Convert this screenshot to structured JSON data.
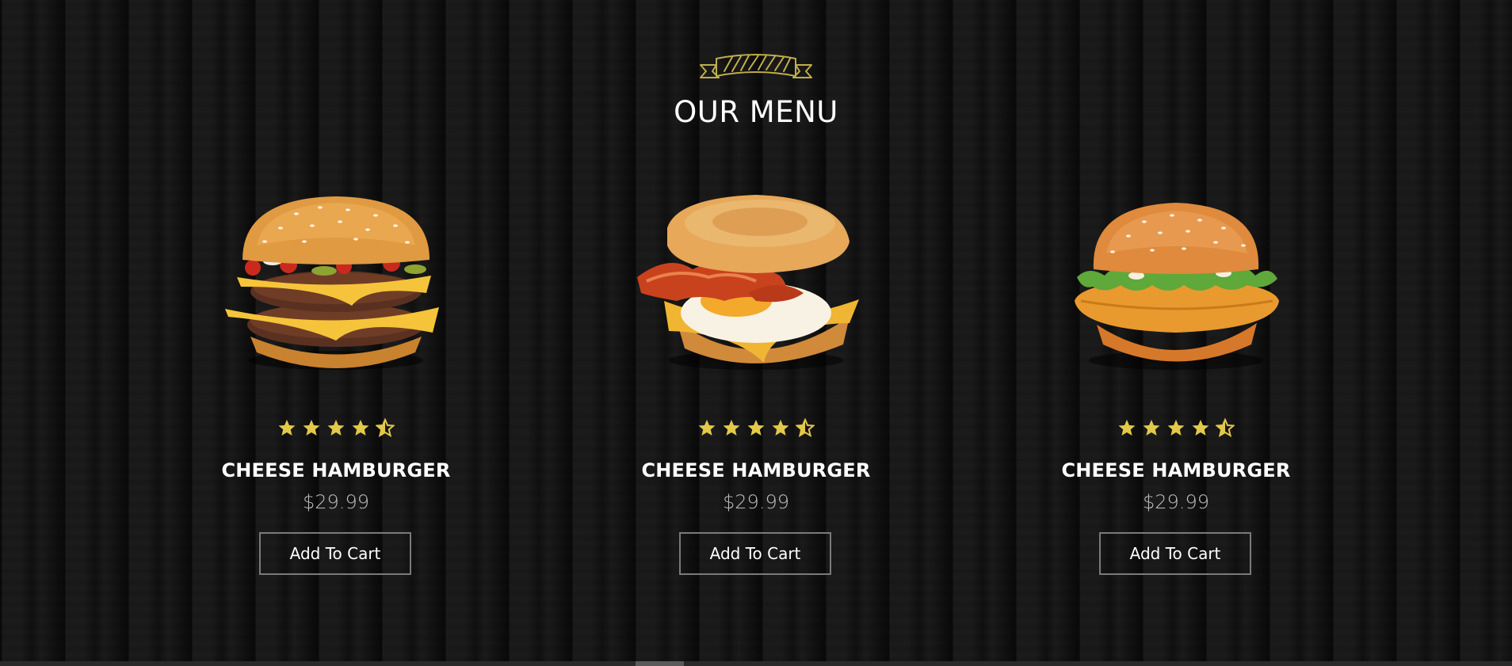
{
  "section": {
    "title": "OUR MENU"
  },
  "colors": {
    "star": "#e2c94a",
    "background": "#141414"
  },
  "menu_items": [
    {
      "name": "CHEESE HAMBURGER",
      "price": "$29.99",
      "rating": 4.5,
      "button": "Add To Cart",
      "image": "double-cheeseburger"
    },
    {
      "name": "CHEESE HAMBURGER",
      "price": "$29.99",
      "rating": 4.5,
      "button": "Add To Cart",
      "image": "bacon-egg-muffin"
    },
    {
      "name": "CHEESE HAMBURGER",
      "price": "$29.99",
      "rating": 4.5,
      "button": "Add To Cart",
      "image": "chicken-burger"
    }
  ]
}
